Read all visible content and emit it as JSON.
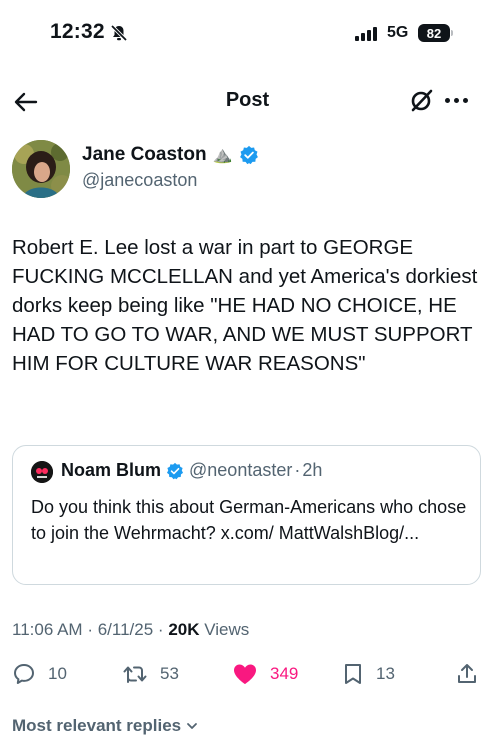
{
  "status_bar": {
    "time": "12:32",
    "network": "5G",
    "battery": "82"
  },
  "nav": {
    "title": "Post"
  },
  "author": {
    "name": "Jane Coaston",
    "name_emoji": "⛰️",
    "handle": "@janecoaston"
  },
  "tweet": {
    "text": "Robert E. Lee lost a war in part to GEORGE FUCKING MCCLELLAN and yet America's dorkiest dorks keep being like \"HE HAD NO CHOICE, HE HAD TO GO TO WAR, AND WE MUST SUPPORT HIM FOR CULTURE WAR REASONS\""
  },
  "quote": {
    "name": "Noam Blum",
    "handle": "@neontaster",
    "separator": "·",
    "time": "2h",
    "text": "Do you think this about German-Americans who chose to join the Wehrmacht? x.com/ MattWalshBlog/..."
  },
  "meta": {
    "time": "11:06 AM",
    "date": "6/11/25",
    "separator": "·",
    "views_count": "20K",
    "views_label": "Views"
  },
  "actions": {
    "replies": "10",
    "reposts": "53",
    "likes": "349",
    "bookmarks": "13"
  },
  "footer": {
    "replies_sort": "Most relevant replies"
  },
  "colors": {
    "like": "#f91880",
    "verified": "#1d9bf0",
    "secondary_text": "#536471"
  }
}
